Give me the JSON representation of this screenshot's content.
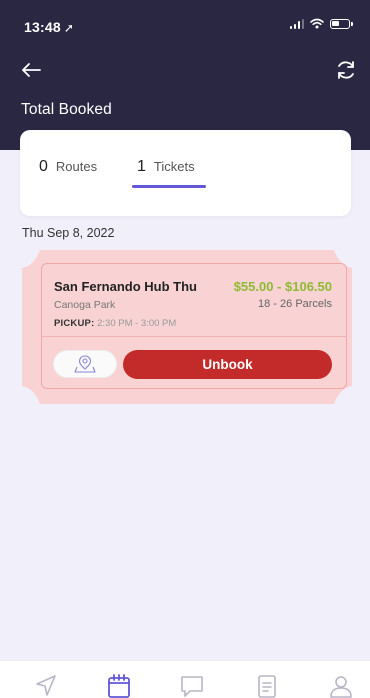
{
  "status_bar": {
    "time": "13:48",
    "location_icon": "location-arrow-icon",
    "signal_icon": "cellular-signal-icon",
    "wifi_icon": "wifi-icon",
    "battery_icon": "battery-icon"
  },
  "header": {
    "back_icon": "arrow-left-icon",
    "refresh_icon": "refresh-icon",
    "title": "Total Booked"
  },
  "tabs": [
    {
      "count": "0",
      "label": "Routes",
      "active": false
    },
    {
      "count": "1",
      "label": "Tickets",
      "active": true
    }
  ],
  "date_heading": "Thu Sep 8, 2022",
  "ticket": {
    "route_name": "San Fernando Hub Thu",
    "price": "$55.00 - $106.50",
    "origin": "Canoga Park",
    "parcels": "18 - 26 Parcels",
    "pickup_label": "PICKUP:",
    "pickup_time": "2:30 PM - 3:00 PM",
    "map_icon": "map-pin-icon",
    "unbook_label": "Unbook"
  },
  "tab_bar": [
    {
      "icon": "navigation-icon",
      "active": false
    },
    {
      "icon": "calendar-icon",
      "active": true
    },
    {
      "icon": "chat-icon",
      "active": false
    },
    {
      "icon": "document-icon",
      "active": false
    },
    {
      "icon": "profile-icon",
      "active": false
    }
  ],
  "colors": {
    "header_bg": "#2a2743",
    "page_bg": "#f1f0fa",
    "accent": "#6257d9",
    "price_green": "#8dbb34",
    "unbook_red": "#c32a2a",
    "ticket_bg": "#f9d3d3",
    "inactive_icon": "#b8b6c6"
  }
}
